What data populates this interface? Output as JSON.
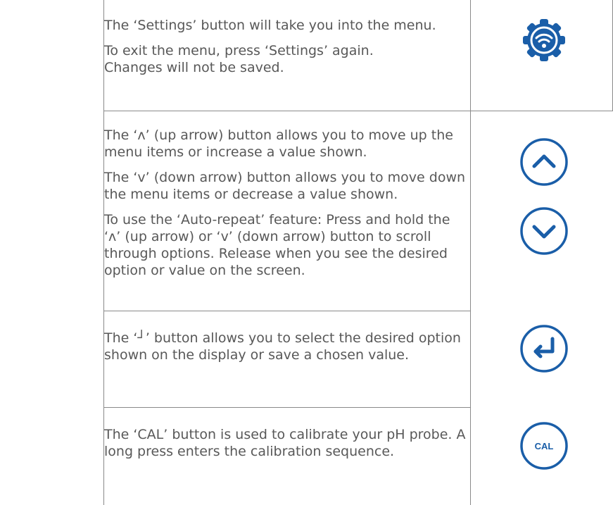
{
  "rows": [
    {
      "paragraphs": [
        "The ‘Settings’ button will take you into the menu.",
        "To exit the menu, press ‘Settings’ again. Changes will not be saved."
      ],
      "icons": [
        "settings-icon"
      ]
    },
    {
      "paragraphs": [
        "The ‘ʌ’ (up arrow) button allows you to move up the menu items or increase a value shown.",
        "The ‘v’ (down arrow) button allows you to move down the menu items or decrease a value shown.",
        "To use the ‘Auto-repeat’ feature: Press and hold the ‘ʌ’ (up arrow) or ‘v’ (down arrow) button to scroll through options. Release when you see the desired option or value on the screen."
      ],
      "icons": [
        "chevron-up-icon",
        "chevron-down-icon"
      ]
    },
    {
      "paragraphs": [
        "The ‘┘’ button allows you to select the desired option shown on the display or save a chosen value."
      ],
      "icons": [
        "enter-icon"
      ]
    },
    {
      "paragraphs": [
        "The ‘CAL’ button is used to calibrate your pH probe. A long press enters the calibration sequence."
      ],
      "icons": [
        "cal-button-icon"
      ],
      "cal_label": "CAL"
    }
  ],
  "colors": {
    "accent": "#1a5ea8",
    "border": "#8a8a8a",
    "text": "#585858"
  }
}
